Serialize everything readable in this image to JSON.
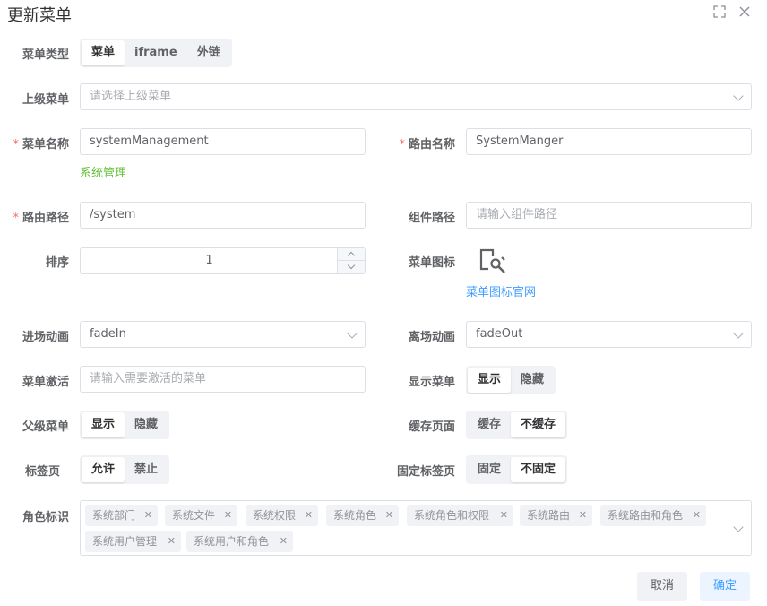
{
  "dialog": {
    "title": "更新菜单"
  },
  "form": {
    "menu_type": {
      "label": "菜单类型",
      "options": [
        "菜单",
        "iframe",
        "外链"
      ],
      "selected": "菜单"
    },
    "parent_menu": {
      "label": "上级菜单",
      "placeholder": "请选择上级菜单"
    },
    "menu_name": {
      "label": "菜单名称",
      "value": "systemManagement",
      "hint": "系统管理"
    },
    "route_name": {
      "label": "路由名称",
      "value": "SystemManger"
    },
    "route_path": {
      "label": "路由路径",
      "value": "/system"
    },
    "component_path": {
      "label": "组件路径",
      "placeholder": "请输入组件路径"
    },
    "sort": {
      "label": "排序",
      "value": "1"
    },
    "menu_icon": {
      "label": "菜单图标",
      "icon": "settings-wrench-icon",
      "link": "菜单图标官网"
    },
    "enter_animation": {
      "label": "进场动画",
      "value": "fadeIn"
    },
    "leave_animation": {
      "label": "离场动画",
      "value": "fadeOut"
    },
    "menu_active": {
      "label": "菜单激活",
      "placeholder": "请输入需要激活的菜单"
    },
    "show_menu": {
      "label": "显示菜单",
      "options": [
        "显示",
        "隐藏"
      ],
      "selected": "显示"
    },
    "parent_show": {
      "label": "父级菜单",
      "options": [
        "显示",
        "隐藏"
      ],
      "selected": "显示"
    },
    "cache_page": {
      "label": "缓存页面",
      "options": [
        "缓存",
        "不缓存"
      ],
      "selected": "不缓存"
    },
    "tab_page": {
      "label": "标签页",
      "options": [
        "允许",
        "禁止"
      ],
      "selected": "允许"
    },
    "fixed_tab": {
      "label": "固定标签页",
      "options": [
        "固定",
        "不固定"
      ],
      "selected": "不固定"
    },
    "roles": {
      "label": "角色标识",
      "tags": [
        "系统部门",
        "系统文件",
        "系统权限",
        "系统角色",
        "系统角色和权限",
        "系统路由",
        "系统路由和角色",
        "系统用户管理",
        "系统用户和角色"
      ]
    }
  },
  "footer": {
    "cancel": "取消",
    "confirm": "确定"
  },
  "colors": {
    "accent": "#409eff",
    "success": "#67c23a",
    "required": "#f56c6c"
  }
}
